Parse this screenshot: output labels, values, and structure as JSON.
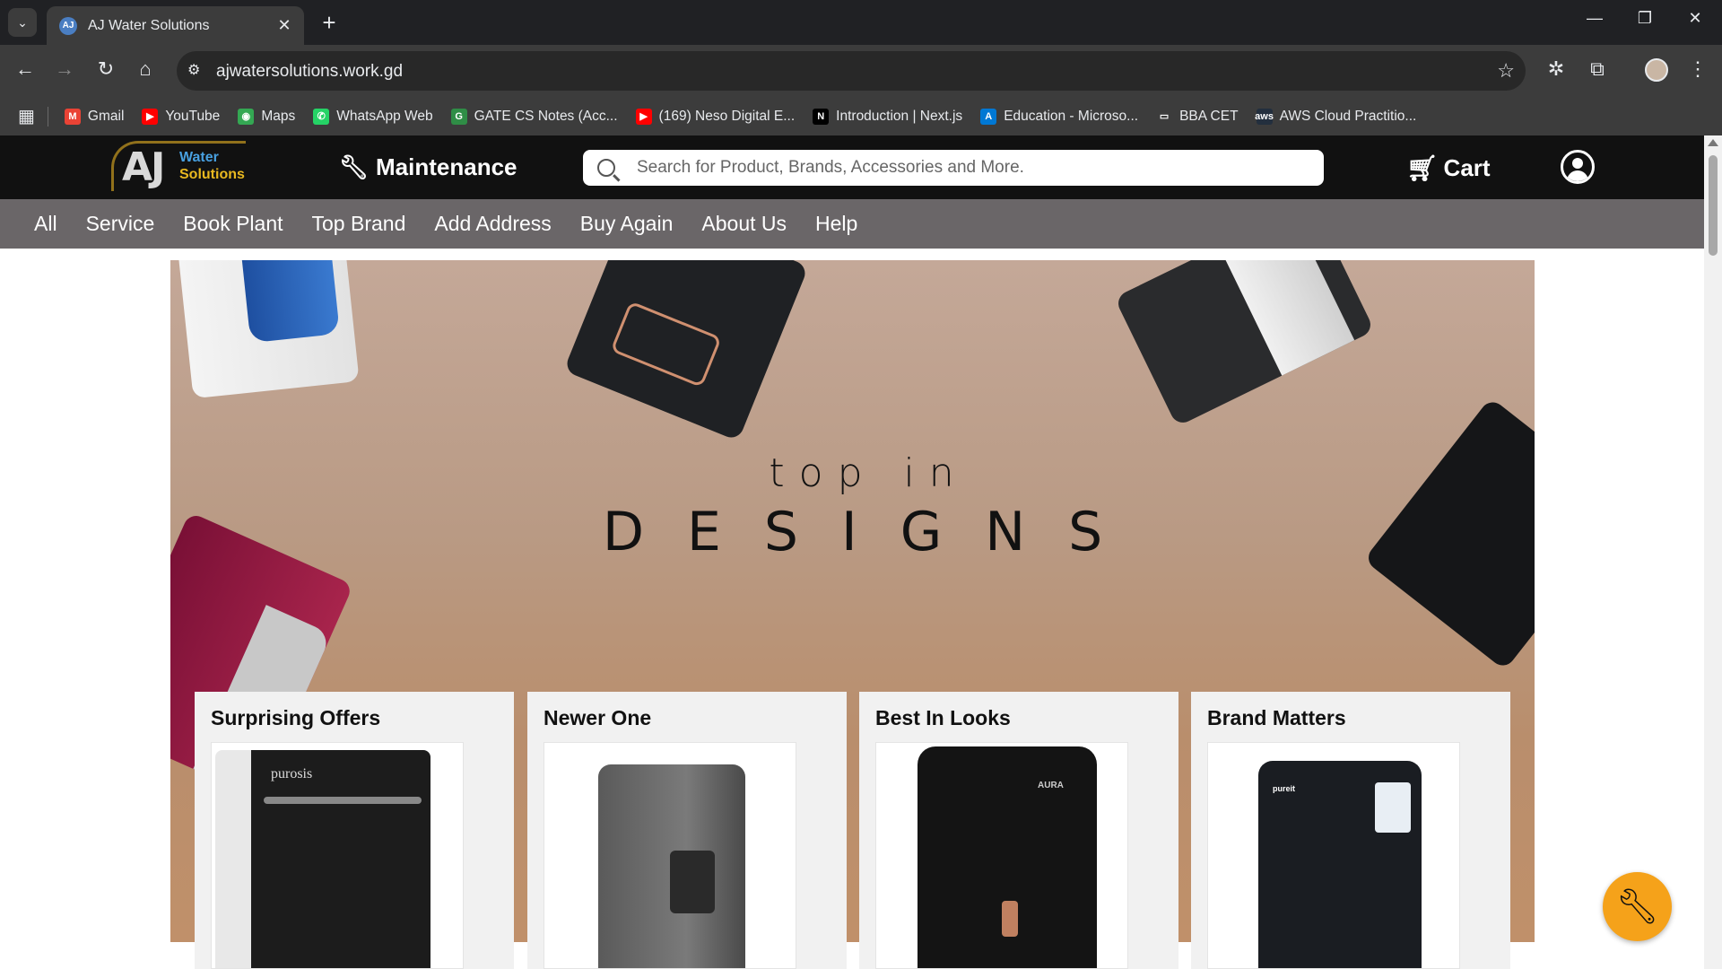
{
  "browser": {
    "tab_title": "AJ Water Solutions",
    "tab_close": "✕",
    "new_tab": "+",
    "url": "ajwatersolutions.work.gd",
    "bookmarks": [
      {
        "label": "Gmail",
        "color": "#ea4335",
        "glyph": "M"
      },
      {
        "label": "YouTube",
        "color": "#ff0000",
        "glyph": "▶"
      },
      {
        "label": "Maps",
        "color": "#34a853",
        "glyph": "◉"
      },
      {
        "label": "WhatsApp Web",
        "color": "#25d366",
        "glyph": "✆"
      },
      {
        "label": "GATE CS Notes (Acc...",
        "color": "#2f8d46",
        "glyph": "G"
      },
      {
        "label": "(169) Neso Digital E...",
        "color": "#ff0000",
        "glyph": "▶"
      },
      {
        "label": "Introduction | Next.js",
        "color": "#000000",
        "glyph": "N"
      },
      {
        "label": "Education - Microso...",
        "color": "#0078d4",
        "glyph": "A"
      },
      {
        "label": "BBA CET",
        "color": "#3c3c3c",
        "glyph": "▭"
      },
      {
        "label": "AWS Cloud Practitio...",
        "color": "#232f3e",
        "glyph": "aws"
      }
    ]
  },
  "header": {
    "logo_aj": "AJ",
    "logo_water": "Water",
    "logo_solutions": "Solutions",
    "maintenance": "Maintenance",
    "search_placeholder": "Search for Product, Brands, Accessories and More.",
    "cart": "Cart"
  },
  "nav": [
    "All",
    "Service",
    "Book Plant",
    "Top Brand",
    "Add Address",
    "Buy Again",
    "About Us",
    "Help"
  ],
  "hero": {
    "line1": "top in",
    "line2": "DESIGNS"
  },
  "cards": [
    {
      "title": "Surprising Offers",
      "product_text": "purosis"
    },
    {
      "title": "Newer One",
      "product_text": ""
    },
    {
      "title": "Best In Looks",
      "product_text": "AURA"
    },
    {
      "title": "Brand Matters",
      "product_text": "pureit"
    }
  ],
  "colors": {
    "header_bg": "#111111",
    "nav_bg": "#6a6668",
    "fab": "#f5a21a"
  }
}
